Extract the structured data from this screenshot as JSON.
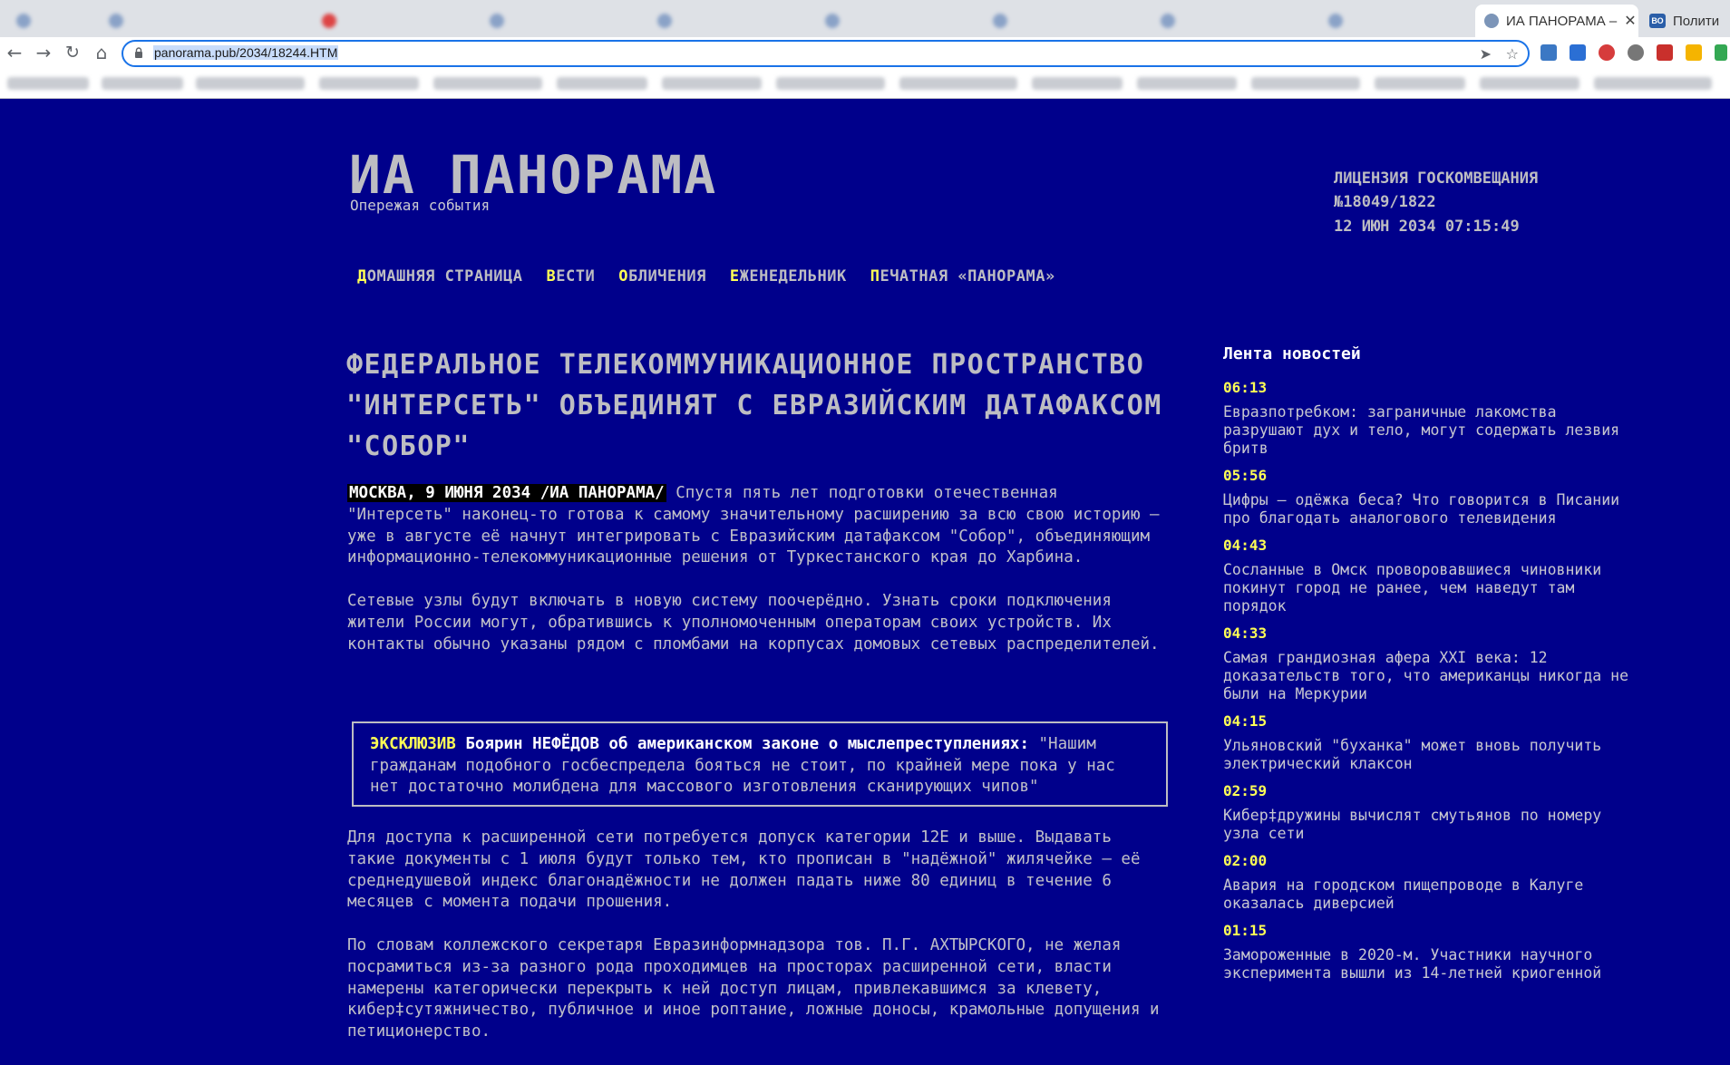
{
  "browser": {
    "tabs": [
      {
        "label": "ИА ПАНОРАМА – ",
        "active": true
      },
      {
        "label": "Полити",
        "active": false
      }
    ],
    "url": "panorama.pub/2034/18244.HTM",
    "close_glyph": "✕"
  },
  "site": {
    "title": "ИА ПАНОРАМА",
    "tagline": "Опережая события",
    "license_line1": "ЛИЦЕНЗИЯ ГОСКОМВЕЩАНИЯ",
    "license_line2": "№18049/1822",
    "datetime": "12 ИЮН 2034 07:15:49"
  },
  "nav": [
    {
      "cap": "Д",
      "rest": "ОМАШНЯЯ СТРАНИЦА"
    },
    {
      "cap": "В",
      "rest": "ЕСТИ"
    },
    {
      "cap": "О",
      "rest": "БЛИЧЕНИЯ"
    },
    {
      "cap": "Е",
      "rest": "ЖЕНЕДЕЛЬНИК"
    },
    {
      "cap": "П",
      "rest": "ЕЧАТНАЯ «ПАНОРАМА»"
    }
  ],
  "article": {
    "headline": "ФЕДЕРАЛЬНОЕ ТЕЛЕКОММУНИКАЦИОННОЕ ПРОСТРАНСТВО \"ИНТЕРСЕТЬ\" ОБЪЕДИНЯТ С ЕВРАЗИЙСКИМ ДАТАФАКСОМ \"СОБОР\"",
    "dateline": "МОСКВА, 9 ИЮНЯ 2034 /ИА ПАНОРАМА/",
    "p1": " Спустя пять лет подготовки отечественная \"Интерсеть\" наконец-то готова к самому значительному расширению за всю свою историю – уже в августе её начнут интегрировать с Евразийским датафаксом \"Собор\", объединяющим информационно-телекоммуникационные решения от Туркестанского края до Харбина.",
    "p2": "Сетевые узлы будут включать в новую систему поочерёдно. Узнать сроки подключения жители России могут, обратившись к уполномоченным операторам своих устройств. Их контакты обычно указаны рядом с пломбами на корпусах домовых сетевых распределителей.",
    "exclusive_tag": "ЭКСКЛЮЗИВ",
    "exclusive_who": " Боярин НЕФЁДОВ об американском законе о мыслепреступлениях:",
    "exclusive_quote": " \"Нашим гражданам подобного госбеспредела бояться не стоит, по крайней мере пока у нас нет достаточно молибдена для массового изготовления сканирующих чипов\"",
    "p3": "Для доступа к расширенной сети потребуется допуск категории 12Е и выше. Выдавать такие документы с 1 июля будут только тем, кто прописан в \"надёжной\" жилячейке – её среднедушевой индекс благонадёжности не должен падать ниже 80 единиц в течение 6 месяцев с момента подачи прошения.",
    "p4": "По словам коллежского секретаря Евразинформнадзора тов. П.Г. АХТЫРСКОГО, не желая посрамиться из-за разного рода проходимцев на просторах расширенной сети, власти намерены категорически перекрыть к ней доступ лицам, привлекавшимся за клевету, кибер‡сутяжничество, публичное и иное роптание, ложные доносы, крамольные допущения и петиционерство."
  },
  "feed": {
    "title": "Лента новостей",
    "items": [
      {
        "time": "06:13",
        "text": "Евразпотребком: заграничные лакомства разрушают дух и тело, могут содержать лезвия бритв"
      },
      {
        "time": "05:56",
        "text": "Цифры – одёжка беса? Что говорится в Писании про благодать аналогового телевидения"
      },
      {
        "time": "04:43",
        "text": "Сосланные в Омск проворовавшиеся чиновники покинут город не ранее, чем наведут там порядок"
      },
      {
        "time": "04:33",
        "text": "Самая грандиозная афера XXI века: 12 доказательств того, что американцы никогда не были на Меркурии"
      },
      {
        "time": "04:15",
        "text": "Ульяновский \"буханка\" может вновь получить электрический клаксон"
      },
      {
        "time": "02:59",
        "text": "Кибер‡дружины вычислят смутьянов по номеру узла сети"
      },
      {
        "time": "02:00",
        "text": "Авария на городском пищепроводе в Калуге оказалась диверсией"
      },
      {
        "time": "01:15",
        "text": "Замороженные в 2020-м. Участники научного эксперимента вышли из 14-летней криогенной"
      }
    ]
  }
}
